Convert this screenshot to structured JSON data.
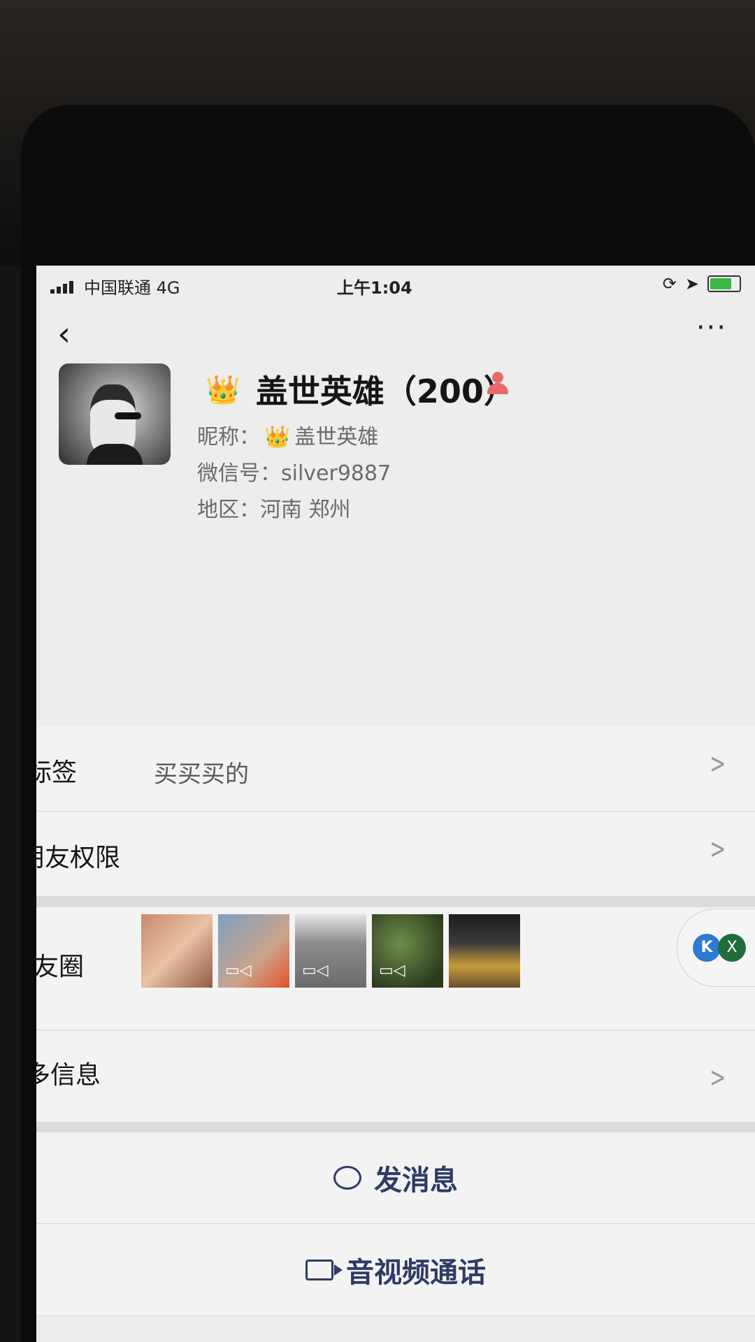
{
  "status": {
    "carrier": "中国联通  4G",
    "time": "上午1:04"
  },
  "nav": {
    "back_icon": "chevron-left-icon",
    "more_label": "···"
  },
  "profile": {
    "name": "盖世英雄（200）",
    "nickname_label": "昵称：",
    "nickname": "盖世英雄",
    "wechat_id_label": "微信号：",
    "wechat_id": "silver9887",
    "region_label": "地区：",
    "region": "河南 郑州",
    "crown_emoji": "👑"
  },
  "rows": {
    "tags_label": "标签",
    "tags_value": "买买买的",
    "permission_label": "朋友权限",
    "moments_label": "朋友圈",
    "more_info_label": "更多信息"
  },
  "floating_widget": {
    "kk_label": "K",
    "close_label": "X"
  },
  "actions": {
    "message_label": "发消息",
    "call_label": "音视频通话"
  },
  "colors": {
    "accent": "#2f3b66",
    "background": "#ededed"
  }
}
